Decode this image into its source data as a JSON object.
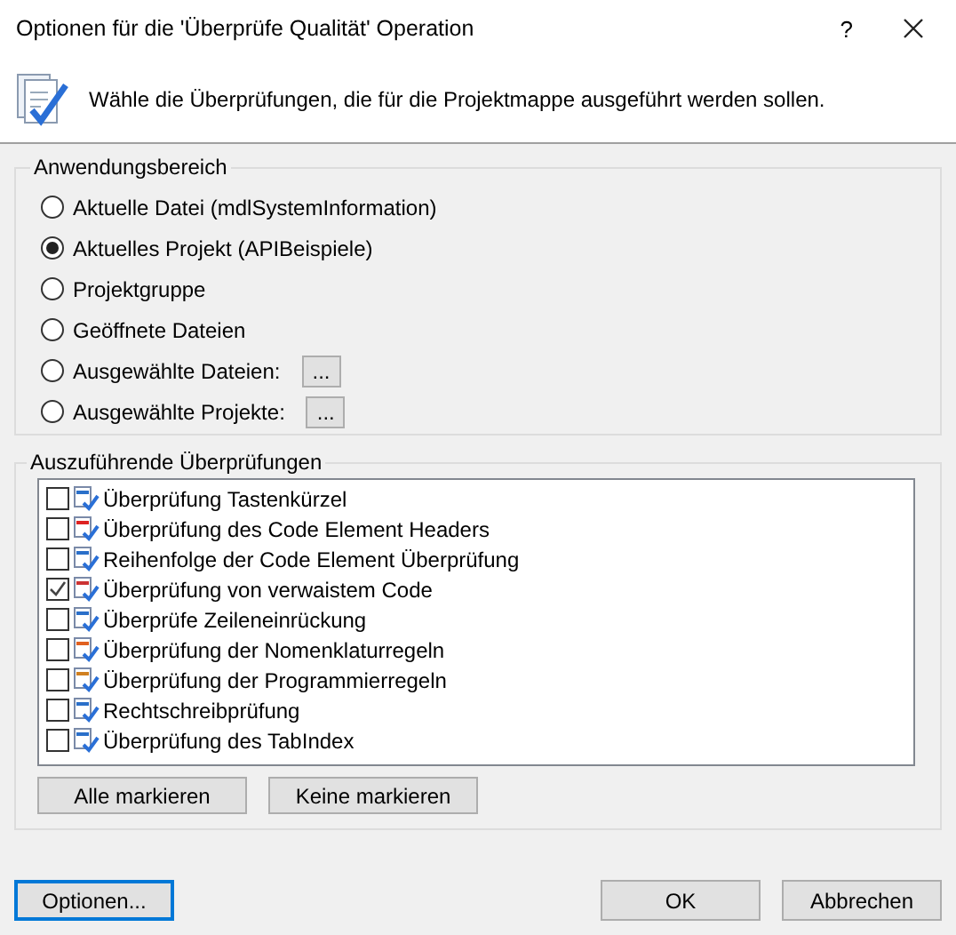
{
  "window": {
    "title": "Optionen für die 'Überprüfe Qualität' Operation",
    "help": "?"
  },
  "header": {
    "text": "Wähle die Überprüfungen, die für die Projektmappe ausgeführt werden sollen."
  },
  "scope": {
    "title": "Anwendungsbereich",
    "options": [
      {
        "label": "Aktuelle Datei (mdlSystemInformation)",
        "selected": false,
        "kind": "plain"
      },
      {
        "label": "Aktuelles Projekt (APIBeispiele)",
        "selected": true,
        "kind": "plain"
      },
      {
        "label": "Projektgruppe",
        "selected": false,
        "kind": "plain"
      },
      {
        "label": "Geöffnete Dateien",
        "selected": false,
        "kind": "plain"
      },
      {
        "label": "Ausgewählte Dateien:",
        "selected": false,
        "kind": "browse",
        "button": "..."
      },
      {
        "label": "Ausgewählte Projekte:",
        "selected": false,
        "kind": "browse",
        "button": "..."
      }
    ]
  },
  "checks": {
    "title": "Auszuführende Überprüfungen",
    "items": [
      {
        "label": "Überprüfung Tastenkürzel",
        "checked": false
      },
      {
        "label": "Überprüfung des Code Element Headers",
        "checked": false
      },
      {
        "label": "Reihenfolge der Code Element Überprüfung",
        "checked": false
      },
      {
        "label": "Überprüfung von verwaistem Code",
        "checked": true
      },
      {
        "label": "Überprüfe Zeileneinrückung",
        "checked": false
      },
      {
        "label": "Überprüfung der Nomenklaturregeln",
        "checked": false
      },
      {
        "label": "Überprüfung der Programmierregeln",
        "checked": false
      },
      {
        "label": "Rechtschreibprüfung",
        "checked": false
      },
      {
        "label": "Überprüfung des TabIndex",
        "checked": false
      }
    ],
    "buttons": [
      "Alle markieren",
      "Keine markieren"
    ]
  },
  "footer": {
    "options_button": "Optionen...",
    "ok": "OK",
    "cancel": "Abbrechen"
  }
}
